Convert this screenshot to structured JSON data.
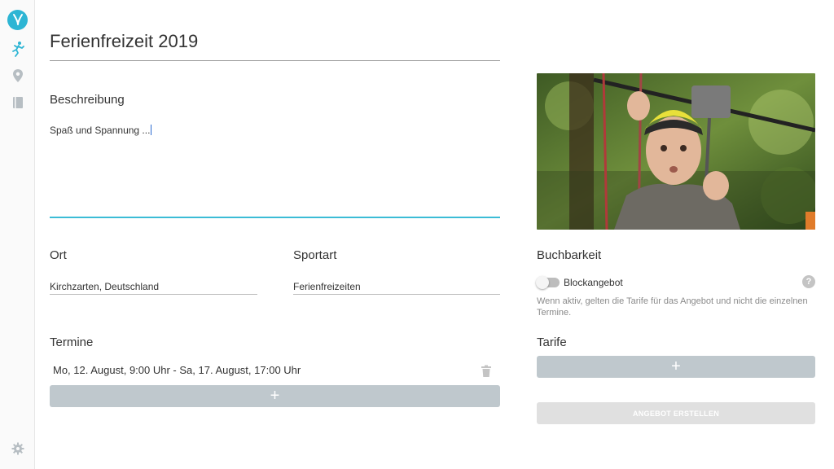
{
  "colors": {
    "accent": "#2db5d4",
    "input_focus": "#3cbcd6",
    "button_grey": "#bfc8cd",
    "disabled_button": "#e0e0e0",
    "hint_text": "#8a8a8a"
  },
  "sidebar": {
    "items": [
      {
        "icon": "logo-icon"
      },
      {
        "icon": "sport-figure-icon"
      },
      {
        "icon": "location-pin-icon"
      },
      {
        "icon": "book-icon"
      },
      {
        "icon": "gear-icon"
      }
    ]
  },
  "page": {
    "title": "Ferienfreizeit 2019"
  },
  "description": {
    "label": "Beschreibung",
    "value": "Spaß und Spannung ..."
  },
  "location": {
    "label": "Ort",
    "value": "Kirchzarten, Deutschland"
  },
  "sport": {
    "label": "Sportart",
    "value": "Ferienfreizeiten"
  },
  "dates": {
    "label": "Termine",
    "items": [
      "Mo, 12. August, 9:00 Uhr - Sa, 17. August, 17:00 Uhr"
    ],
    "add_label": "+"
  },
  "booking": {
    "label": "Buchbarkeit",
    "toggle_label": "Blockangebot",
    "toggle_on": false,
    "help_label": "?",
    "hint": "Wenn aktiv, gelten die Tarife für das Angebot und nicht die einzelnen Termine."
  },
  "rates": {
    "label": "Tarife",
    "add_label": "+"
  },
  "submit": {
    "label": "ANGEBOT ERSTELLEN"
  }
}
